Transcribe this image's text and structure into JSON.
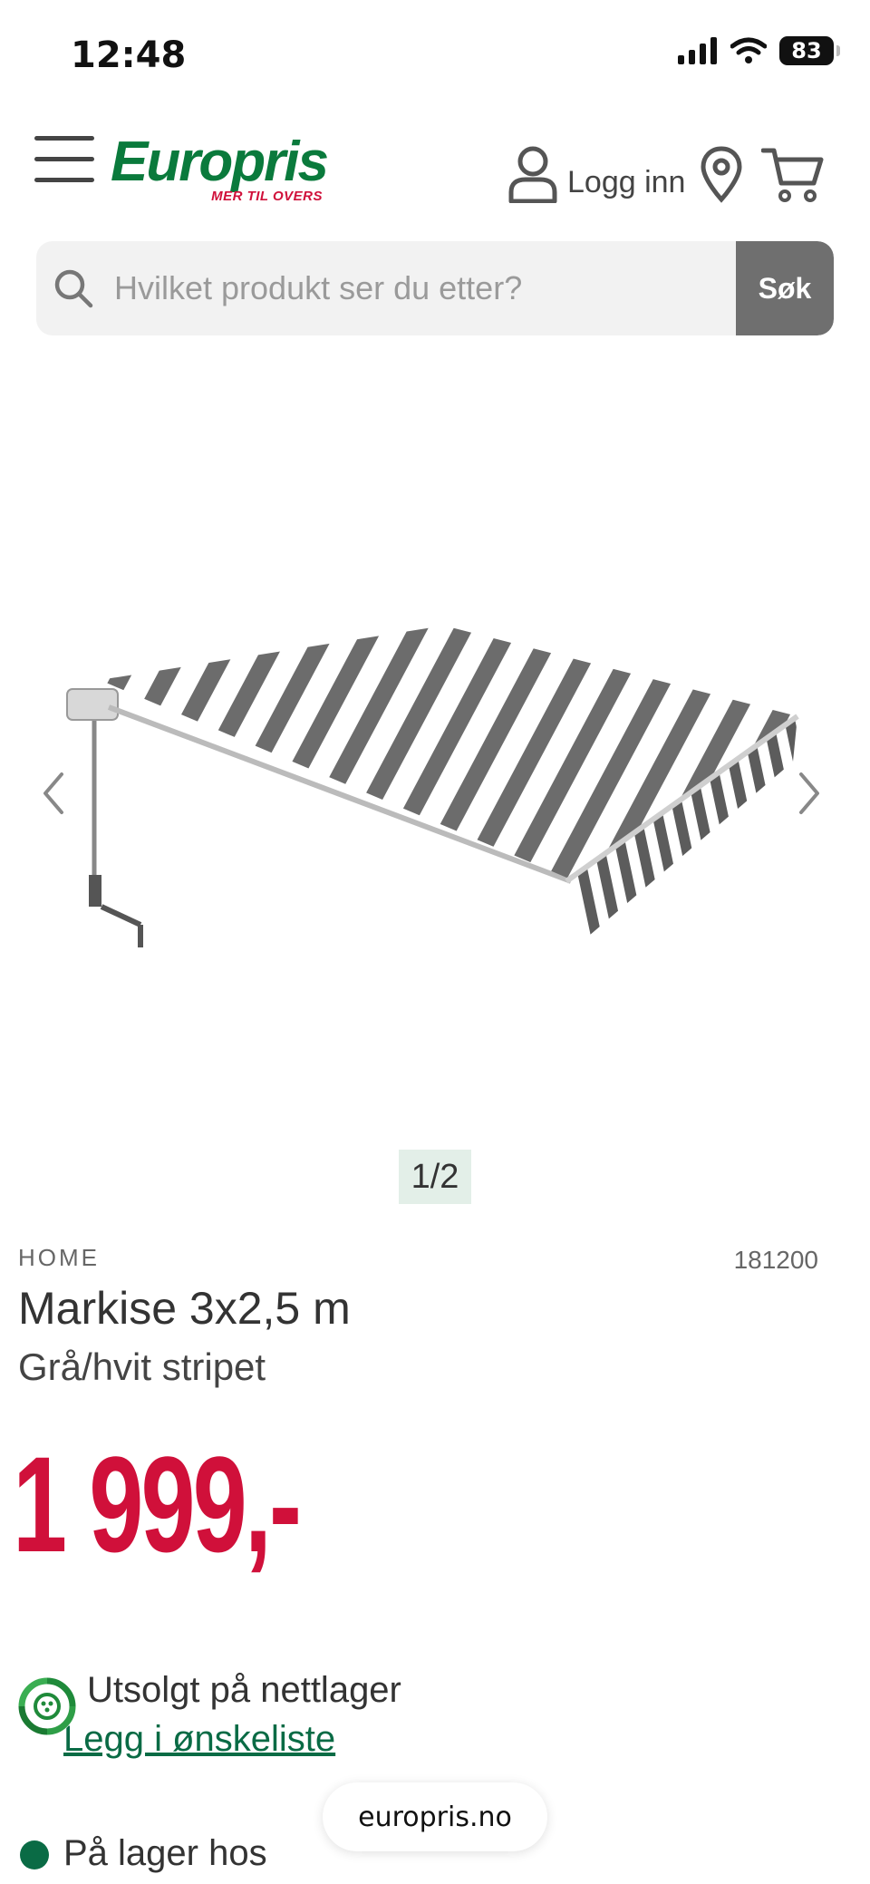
{
  "status_bar": {
    "time": "12:48",
    "battery": "83"
  },
  "header": {
    "logo_text": "Europris",
    "logo_tagline": "MER TIL OVERS",
    "login_label": "Logg inn"
  },
  "search": {
    "placeholder": "Hvilket produkt ser du etter?",
    "button_label": "Søk"
  },
  "gallery": {
    "pager": "1/2"
  },
  "product": {
    "brand": "HOME",
    "sku": "181200",
    "title": "Markise 3x2,5 m",
    "variant": "Grå/hvit stripet",
    "price": "1 999,-"
  },
  "availability": {
    "online_status": "Utsolgt på nettlager",
    "wishlist_label": "Legg i ønskeliste",
    "store_status": "På lager hos"
  },
  "browser": {
    "url": "europris.no"
  },
  "colors": {
    "brand_green": "#0a7a3c",
    "price_red": "#d0103a",
    "link_green": "#0a6b45"
  }
}
